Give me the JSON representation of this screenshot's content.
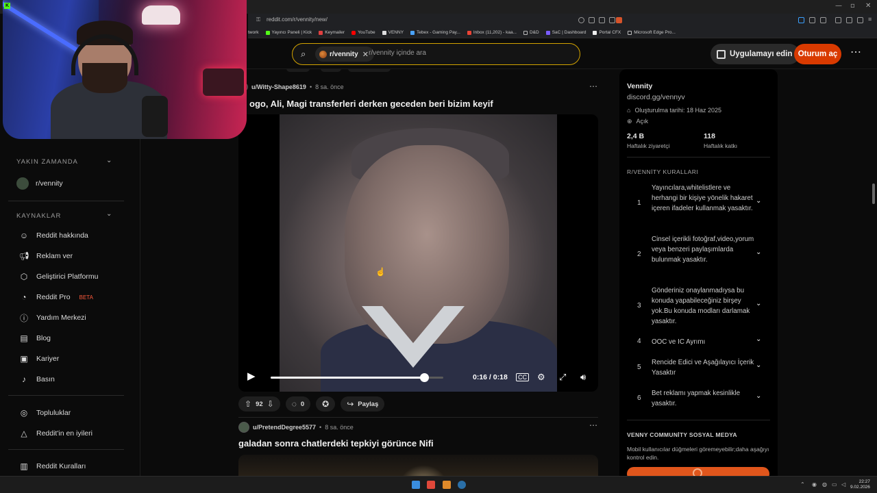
{
  "browser": {
    "url": "reddit.com/r/vennity/new/",
    "bookmarks": [
      "twork",
      "Yayıncı Paneli | Kick",
      "Keymailer",
      "YouTube",
      "VENNY",
      "Tebex - Gaming Pay...",
      "Inbox (11,202) - kaa...",
      "D&D",
      "SaC | Dashboard",
      "Portal CFX",
      "Microsoft Edge Pro..."
    ]
  },
  "header": {
    "subreddit_chip": "r/vennity",
    "search_placeholder": "r/vennity içinde ara",
    "get_app": "Uygulamayı edin",
    "login": "Oturum aç",
    "more": "⋯"
  },
  "sidebar": {
    "recent_header": "YAKIN ZAMANDA",
    "recent_item": "r/vennity",
    "resources_header": "KAYNAKLAR",
    "resources": [
      {
        "label": "Reddit hakkında",
        "icon": "reddit-alien-icon"
      },
      {
        "label": "Reklam ver",
        "icon": "megaphone-icon"
      },
      {
        "label": "Geliştirici Platformu",
        "icon": "developer-icon"
      },
      {
        "label": "Reddit Pro",
        "icon": "pro-icon",
        "badge": "BETA"
      },
      {
        "label": "Yardım Merkezi",
        "icon": "help-icon"
      },
      {
        "label": "Blog",
        "icon": "book-icon"
      },
      {
        "label": "Kariyer",
        "icon": "briefcase-icon"
      },
      {
        "label": "Basın",
        "icon": "microphone-icon"
      }
    ],
    "communities": "Topluluklar",
    "best": "Reddit'in en iyileri",
    "rules": "Reddit Kuralları"
  },
  "feed": {
    "posts": [
      {
        "author": "u/Witty-Shape8619",
        "time": "8 sa. önce",
        "title": "ogo, Ali, Magi transferleri derken geceden beri bizim keyif",
        "video_time": "0:16 / 0:18",
        "video_progress": 0.89,
        "votes": "92",
        "comments": "0",
        "share": "Paylaş"
      },
      {
        "author": "u/PretendDegree5577",
        "time": "8 sa. önce",
        "title": "galadan sonra chatlerdeki tepkiyi görünce Nifi"
      }
    ]
  },
  "community": {
    "name": "Vennity",
    "link": "discord.gg/vennyv",
    "created": "Oluşturulma tarihi: 18 Haz 2025",
    "visibility": "Açık",
    "weekly_visitors": "2,4 B",
    "weekly_visitors_label": "Haftalık ziyaretçi",
    "weekly_contrib": "118",
    "weekly_contrib_label": "Haftalık katkı",
    "rules_header": "R/VENNİTY KURALLARI",
    "rules": [
      {
        "num": "1",
        "text": "Yayıncılara,whitelistlere ve herhangi bir kişiye yönelik hakaret içeren ifadeler kullanmak yasaktır."
      },
      {
        "num": "2",
        "text": "Cinsel içerikli fotoğraf,video,yorum veya benzeri paylaşımlarda bulunmak yasaktır."
      },
      {
        "num": "3",
        "text": "Gönderiniz onaylanmadıysa bu konuda yapabileceğiniz birşey yok.Bu konuda modları darlamak yasaktır."
      },
      {
        "num": "4",
        "text": "OOC ve IC Ayrımı"
      },
      {
        "num": "5",
        "text": "Rencide Edici ve Aşağılayıcı İçerik Yasaktır"
      },
      {
        "num": "6",
        "text": "Bet reklamı yapmak kesinlikle yasaktır."
      }
    ],
    "social_header": "VENNY COMMUNİTY SOSYAL MEDYA",
    "social_note": "Mobil kullanıcılar düğmeleri göremeyebilir;daha aşağıyı kontrol edin."
  },
  "taskbar": {
    "time": "22:27",
    "date": "9.02.2026"
  },
  "colors": {
    "accent": "#d93a00",
    "search_border": "#d4a400"
  }
}
